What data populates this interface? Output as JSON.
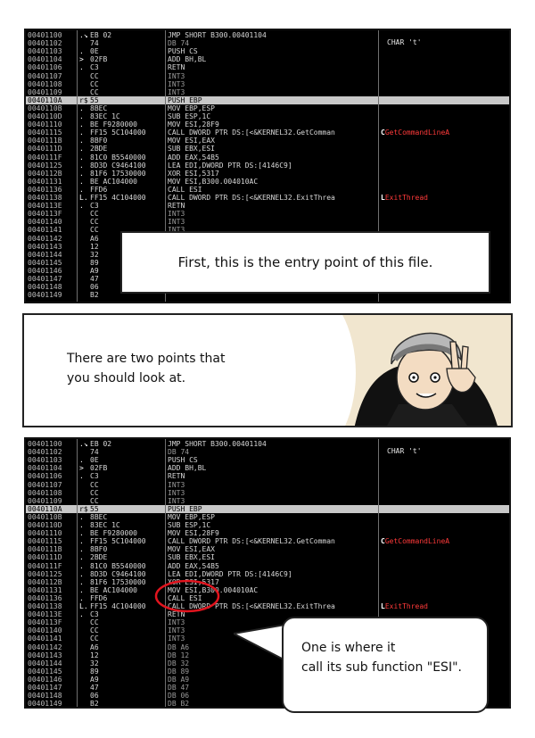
{
  "panel_top": {
    "char_label": "CHAR 't'",
    "rows": [
      {
        "addr": "00401100",
        "mark": ".↘",
        "hex": "EB 02",
        "dis": "JMP SHORT B300.00401104",
        "cmt": ""
      },
      {
        "addr": "00401102",
        "mark": "",
        "hex": "74",
        "dis": "DB 74",
        "cmt": "",
        "dim": true
      },
      {
        "addr": "00401103",
        "mark": ".",
        "hex": "0E",
        "dis": "PUSH CS",
        "cmt": ""
      },
      {
        "addr": "00401104",
        "mark": ">",
        "hex": "02FB",
        "dis": "ADD BH,BL",
        "cmt": ""
      },
      {
        "addr": "00401106",
        "mark": ".",
        "hex": "C3",
        "dis": "RETN",
        "cmt": ""
      },
      {
        "addr": "00401107",
        "mark": "",
        "hex": "CC",
        "dis": "INT3",
        "cmt": "",
        "dim": true
      },
      {
        "addr": "00401108",
        "mark": "",
        "hex": "CC",
        "dis": "INT3",
        "cmt": "",
        "dim": true
      },
      {
        "addr": "00401109",
        "mark": "",
        "hex": "CC",
        "dis": "INT3",
        "cmt": "",
        "dim": true
      },
      {
        "addr": "0040110A",
        "mark": "r$",
        "hex": "55",
        "dis": "PUSH EBP",
        "cmt": "",
        "hl": true
      },
      {
        "addr": "0040110B",
        "mark": ".",
        "hex": "8BEC",
        "dis": "MOV EBP,ESP",
        "cmt": ""
      },
      {
        "addr": "0040110D",
        "mark": ".",
        "hex": "83EC 1C",
        "dis": "SUB ESP,1C",
        "cmt": ""
      },
      {
        "addr": "00401110",
        "mark": ".",
        "hex": "BE F9280000",
        "dis": "MOV ESI,28F9",
        "cmt": ""
      },
      {
        "addr": "00401115",
        "mark": ".",
        "hex": "FF15 5C104000",
        "dis": "CALL DWORD PTR DS:[<&KERNEL32.GetComman",
        "cmt": "GetCommandLineA",
        "arrow": "C"
      },
      {
        "addr": "0040111B",
        "mark": ".",
        "hex": "8BF0",
        "dis": "MOV ESI,EAX",
        "cmt": ""
      },
      {
        "addr": "0040111D",
        "mark": ".",
        "hex": "2BDE",
        "dis": "SUB EBX,ESI",
        "cmt": ""
      },
      {
        "addr": "0040111F",
        "mark": ".",
        "hex": "81C0 B5540000",
        "dis": "ADD EAX,54B5",
        "cmt": ""
      },
      {
        "addr": "00401125",
        "mark": ".",
        "hex": "8D3D C9464100",
        "dis": "LEA EDI,DWORD PTR DS:[4146C9]",
        "cmt": ""
      },
      {
        "addr": "0040112B",
        "mark": ".",
        "hex": "81F6 17530000",
        "dis": "XOR ESI,5317",
        "cmt": ""
      },
      {
        "addr": "00401131",
        "mark": ".",
        "hex": "BE AC104000",
        "dis": "MOV ESI,B300.004010AC",
        "cmt": ""
      },
      {
        "addr": "00401136",
        "mark": ".",
        "hex": "FFD6",
        "dis": "CALL ESI",
        "cmt": ""
      },
      {
        "addr": "00401138",
        "mark": "L.",
        "hex": "FF15 4C104000",
        "dis": "CALL DWORD PTR DS:[<&KERNEL32.ExitThrea",
        "cmt": "ExitThread",
        "arrow": "L"
      },
      {
        "addr": "0040113E",
        "mark": ".",
        "hex": "C3",
        "dis": "RETN",
        "cmt": ""
      },
      {
        "addr": "0040113F",
        "mark": "",
        "hex": "CC",
        "dis": "INT3",
        "cmt": "",
        "dim": true
      },
      {
        "addr": "00401140",
        "mark": "",
        "hex": "CC",
        "dis": "INT3",
        "cmt": "",
        "dim": true
      },
      {
        "addr": "00401141",
        "mark": "",
        "hex": "CC",
        "dis": "INT3",
        "cmt": "",
        "dim": true
      },
      {
        "addr": "00401142",
        "mark": "",
        "hex": "A6",
        "dis": "",
        "cmt": ""
      },
      {
        "addr": "00401143",
        "mark": "",
        "hex": "12",
        "dis": "",
        "cmt": ""
      },
      {
        "addr": "00401144",
        "mark": "",
        "hex": "32",
        "dis": "",
        "cmt": ""
      },
      {
        "addr": "00401145",
        "mark": "",
        "hex": "89",
        "dis": "",
        "cmt": ""
      },
      {
        "addr": "00401146",
        "mark": "",
        "hex": "A9",
        "dis": "",
        "cmt": ""
      },
      {
        "addr": "00401147",
        "mark": "",
        "hex": "47",
        "dis": "",
        "cmt": ""
      },
      {
        "addr": "00401148",
        "mark": "",
        "hex": "06",
        "dis": "",
        "cmt": ""
      },
      {
        "addr": "00401149",
        "mark": "",
        "hex": "B2",
        "dis": "",
        "cmt": ""
      }
    ],
    "caption": "First, this is the entry point of this file."
  },
  "panel_middle": {
    "caption_line1": "There are two points that",
    "caption_line2": "you should look at."
  },
  "panel_bottom": {
    "char_label": "CHAR 't'",
    "rows": [
      {
        "addr": "00401100",
        "mark": ".↘",
        "hex": "EB 02",
        "dis": "JMP SHORT B300.00401104",
        "cmt": ""
      },
      {
        "addr": "00401102",
        "mark": "",
        "hex": "74",
        "dis": "DB 74",
        "cmt": "",
        "dim": true
      },
      {
        "addr": "00401103",
        "mark": ".",
        "hex": "0E",
        "dis": "PUSH CS",
        "cmt": ""
      },
      {
        "addr": "00401104",
        "mark": ">",
        "hex": "02FB",
        "dis": "ADD BH,BL",
        "cmt": ""
      },
      {
        "addr": "00401106",
        "mark": ".",
        "hex": "C3",
        "dis": "RETN",
        "cmt": ""
      },
      {
        "addr": "00401107",
        "mark": "",
        "hex": "CC",
        "dis": "INT3",
        "cmt": "",
        "dim": true
      },
      {
        "addr": "00401108",
        "mark": "",
        "hex": "CC",
        "dis": "INT3",
        "cmt": "",
        "dim": true
      },
      {
        "addr": "00401109",
        "mark": "",
        "hex": "CC",
        "dis": "INT3",
        "cmt": "",
        "dim": true
      },
      {
        "addr": "0040110A",
        "mark": "r$",
        "hex": "55",
        "dis": "PUSH EBP",
        "cmt": "",
        "hl": true
      },
      {
        "addr": "0040110B",
        "mark": ".",
        "hex": "8BEC",
        "dis": "MOV EBP,ESP",
        "cmt": ""
      },
      {
        "addr": "0040110D",
        "mark": ".",
        "hex": "83EC 1C",
        "dis": "SUB ESP,1C",
        "cmt": ""
      },
      {
        "addr": "00401110",
        "mark": ".",
        "hex": "BE F9280000",
        "dis": "MOV ESI,28F9",
        "cmt": ""
      },
      {
        "addr": "00401115",
        "mark": ".",
        "hex": "FF15 5C104000",
        "dis": "CALL DWORD PTR DS:[<&KERNEL32.GetComman",
        "cmt": "GetCommandLineA",
        "arrow": "C"
      },
      {
        "addr": "0040111B",
        "mark": ".",
        "hex": "8BF0",
        "dis": "MOV ESI,EAX",
        "cmt": ""
      },
      {
        "addr": "0040111D",
        "mark": ".",
        "hex": "2BDE",
        "dis": "SUB EBX,ESI",
        "cmt": ""
      },
      {
        "addr": "0040111F",
        "mark": ".",
        "hex": "81C0 B5540000",
        "dis": "ADD EAX,54B5",
        "cmt": ""
      },
      {
        "addr": "00401125",
        "mark": ".",
        "hex": "8D3D C9464100",
        "dis": "LEA EDI,DWORD PTR DS:[4146C9]",
        "cmt": ""
      },
      {
        "addr": "0040112B",
        "mark": ".",
        "hex": "81F6 17530000",
        "dis": "XOR ESI,5317",
        "cmt": ""
      },
      {
        "addr": "00401131",
        "mark": ".",
        "hex": "BE AC104000",
        "dis": "MOV ESI,B300.004010AC",
        "cmt": ""
      },
      {
        "addr": "00401136",
        "mark": ".",
        "hex": "FFD6",
        "dis": "CALL ESI",
        "cmt": ""
      },
      {
        "addr": "00401138",
        "mark": "L.",
        "hex": "FF15 4C104000",
        "dis": "CALL DWORD PTR DS:[<&KERNEL32.ExitThrea",
        "cmt": "ExitThread",
        "arrow": "L"
      },
      {
        "addr": "0040113E",
        "mark": ".",
        "hex": "C3",
        "dis": "RETN",
        "cmt": ""
      },
      {
        "addr": "0040113F",
        "mark": "",
        "hex": "CC",
        "dis": "INT3",
        "cmt": "",
        "dim": true
      },
      {
        "addr": "00401140",
        "mark": "",
        "hex": "CC",
        "dis": "INT3",
        "cmt": "",
        "dim": true
      },
      {
        "addr": "00401141",
        "mark": "",
        "hex": "CC",
        "dis": "INT3",
        "cmt": "",
        "dim": true
      },
      {
        "addr": "00401142",
        "mark": "",
        "hex": "A6",
        "dis": "DB A6",
        "cmt": "",
        "dim": true
      },
      {
        "addr": "00401143",
        "mark": "",
        "hex": "12",
        "dis": "DB 12",
        "cmt": "",
        "dim": true
      },
      {
        "addr": "00401144",
        "mark": "",
        "hex": "32",
        "dis": "DB 32",
        "cmt": "",
        "dim": true
      },
      {
        "addr": "00401145",
        "mark": "",
        "hex": "89",
        "dis": "DB 89",
        "cmt": "",
        "dim": true
      },
      {
        "addr": "00401146",
        "mark": "",
        "hex": "A9",
        "dis": "DB A9",
        "cmt": "",
        "dim": true
      },
      {
        "addr": "00401147",
        "mark": "",
        "hex": "47",
        "dis": "DB 47",
        "cmt": "",
        "dim": true
      },
      {
        "addr": "00401148",
        "mark": "",
        "hex": "06",
        "dis": "DB 06",
        "cmt": "",
        "dim": true
      },
      {
        "addr": "00401149",
        "mark": "",
        "hex": "B2",
        "dis": "DB B2",
        "cmt": "",
        "dim": true
      }
    ],
    "bubble_line1": "One is where it",
    "bubble_line2": "call its sub function \"ESI\"."
  },
  "colors": {
    "debugger_bg": "#000000",
    "api_comment": "#ff3a3a",
    "highlight_row": "#c8c8c8",
    "circle": "#e0141e"
  }
}
